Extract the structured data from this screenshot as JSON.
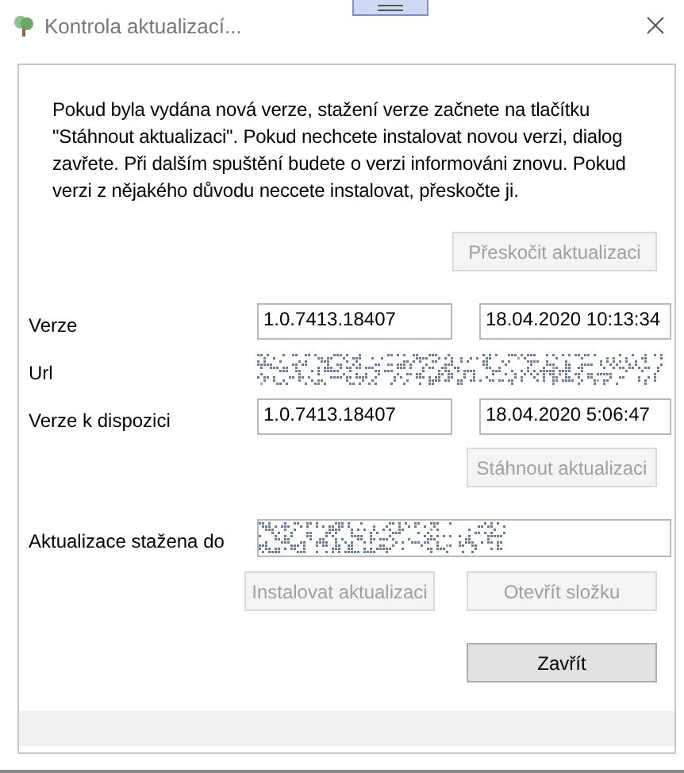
{
  "window": {
    "title": "Kontrola aktualizací..."
  },
  "message": "Pokud byla vydána nová verze, stažení verze začnete na tlačítku \"Stáhnout aktualizaci\". Pokud nechcete instalovat novou verzi, dialog zavřete. Při dalším spuštění budete o verzi informováni znovu. Pokud verzi z nějakého důvodu neccete instalovat, přeskočte ji.",
  "skip_button": {
    "label": "Přeskočit aktualizaci",
    "disabled": true
  },
  "version": {
    "label": "Verze",
    "value": "1.0.7413.18407",
    "date": "18.04.2020 10:13:34"
  },
  "url": {
    "label": "Url"
  },
  "available": {
    "label": "Verze k dispozici",
    "value": "1.0.7413.18407",
    "date": "18.04.2020 5:06:47"
  },
  "download_button": {
    "label": "Stáhnout aktualizaci",
    "disabled": true
  },
  "downloaded_to": {
    "label": "Aktualizace stažena do"
  },
  "install_button": {
    "label": "Instalovat aktualizaci",
    "disabled": true
  },
  "open_folder_button": {
    "label": "Otevřít složku",
    "disabled": true
  },
  "close_button": {
    "label": "Zavřít",
    "disabled": false
  }
}
